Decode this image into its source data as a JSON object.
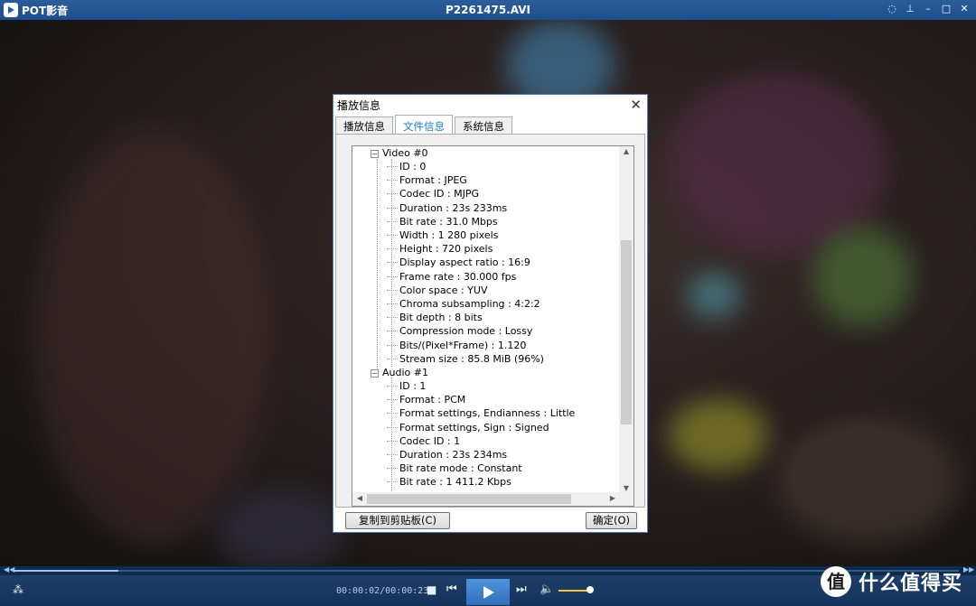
{
  "window": {
    "app_name": "POT影音",
    "file_title": "P2261475.AVI"
  },
  "dialog": {
    "title": "播放信息",
    "tabs": [
      {
        "label": "播放信息",
        "active": false
      },
      {
        "label": "文件信息",
        "active": true
      },
      {
        "label": "系统信息",
        "active": false
      }
    ],
    "video_group": {
      "label": "Video #0",
      "items": [
        "ID : 0",
        "Format : JPEG",
        "Codec ID : MJPG",
        "Duration : 23s 233ms",
        "Bit rate : 31.0 Mbps",
        "Width : 1 280 pixels",
        "Height : 720 pixels",
        "Display aspect ratio : 16:9",
        "Frame rate : 30.000 fps",
        "Color space : YUV",
        "Chroma subsampling : 4:2:2",
        "Bit depth : 8 bits",
        "Compression mode : Lossy",
        "Bits/(Pixel*Frame) : 1.120",
        "Stream size : 85.8 MiB (96%)"
      ]
    },
    "audio_group": {
      "label": "Audio #1",
      "items": [
        "ID : 1",
        "Format : PCM",
        "Format settings, Endianness : Little",
        "Format settings, Sign : Signed",
        "Codec ID : 1",
        "Duration : 23s 234ms",
        "Bit rate mode : Constant",
        "Bit rate : 1 411.2 Kbps"
      ]
    },
    "copy_button": "复制到剪贴板(C)",
    "ok_button": "确定(O)"
  },
  "player": {
    "time_display": "00:00:02/00:00:23",
    "seek_progress": 0.11,
    "volume_level": 0.9
  },
  "watermark": {
    "badge": "值",
    "text": "什么值得买"
  },
  "colors": {
    "titlebar": "#1d4f8d",
    "accent": "#1a7cd8",
    "controls": "#14315a"
  }
}
